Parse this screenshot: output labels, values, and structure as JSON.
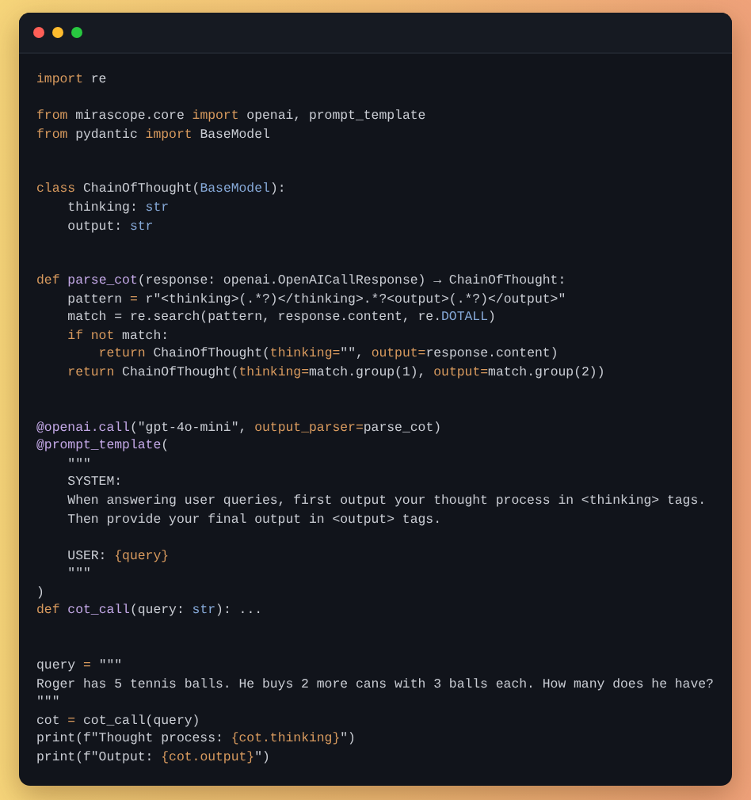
{
  "window": {
    "controls": [
      {
        "color": "#ff5f57"
      },
      {
        "color": "#febc2e"
      },
      {
        "color": "#28c840"
      }
    ]
  },
  "code": {
    "lines": [
      {
        "kind": "code",
        "tokens": [
          {
            "kind": "keyword",
            "text": "import"
          },
          {
            "kind": "plain",
            "text": " re"
          }
        ]
      },
      {
        "kind": "blank"
      },
      {
        "kind": "code",
        "tokens": [
          {
            "kind": "keyword",
            "text": "from"
          },
          {
            "kind": "plain",
            "text": " mirascope.core "
          },
          {
            "kind": "keyword",
            "text": "import"
          },
          {
            "kind": "plain",
            "text": " openai, prompt_template"
          }
        ]
      },
      {
        "kind": "code",
        "tokens": [
          {
            "kind": "keyword",
            "text": "from"
          },
          {
            "kind": "plain",
            "text": " pydantic "
          },
          {
            "kind": "keyword",
            "text": "import"
          },
          {
            "kind": "plain",
            "text": " BaseModel"
          }
        ]
      },
      {
        "kind": "blank"
      },
      {
        "kind": "blank"
      },
      {
        "kind": "code",
        "tokens": [
          {
            "kind": "keyword",
            "text": "class"
          },
          {
            "kind": "plain",
            "text": " ChainOfThought("
          },
          {
            "kind": "type",
            "text": "BaseModel"
          },
          {
            "kind": "plain",
            "text": "):"
          }
        ]
      },
      {
        "kind": "code",
        "tokens": [
          {
            "kind": "plain",
            "text": "    thinking: "
          },
          {
            "kind": "type",
            "text": "str"
          }
        ]
      },
      {
        "kind": "code",
        "tokens": [
          {
            "kind": "plain",
            "text": "    output: "
          },
          {
            "kind": "type",
            "text": "str"
          }
        ]
      },
      {
        "kind": "blank"
      },
      {
        "kind": "blank"
      },
      {
        "kind": "code",
        "tokens": [
          {
            "kind": "keyword",
            "text": "def"
          },
          {
            "kind": "function",
            "text": " parse_cot"
          },
          {
            "kind": "plain",
            "text": "(response: openai.OpenAICallResponse) → ChainOfThought:"
          }
        ]
      },
      {
        "kind": "code",
        "tokens": [
          {
            "kind": "plain",
            "text": "    pattern "
          },
          {
            "kind": "keyword",
            "text": "="
          },
          {
            "kind": "plain",
            "text": " r\"<thinking>(.*?)</thinking>.*?<output>(.*?)</output>\""
          }
        ]
      },
      {
        "kind": "code",
        "tokens": [
          {
            "kind": "plain",
            "text": "    match = re.search(pattern, response.content, re."
          },
          {
            "kind": "type",
            "text": "DOTALL"
          },
          {
            "kind": "plain",
            "text": ")"
          }
        ]
      },
      {
        "kind": "code",
        "tokens": [
          {
            "kind": "keyword",
            "text": "    if not"
          },
          {
            "kind": "plain",
            "text": " match:"
          }
        ]
      },
      {
        "kind": "code",
        "tokens": [
          {
            "kind": "keyword",
            "text": "        return"
          },
          {
            "kind": "plain",
            "text": " ChainOfThought("
          },
          {
            "kind": "keyword",
            "text": "thinking="
          },
          {
            "kind": "plain",
            "text": "\"\", "
          },
          {
            "kind": "keyword",
            "text": "output="
          },
          {
            "kind": "plain",
            "text": "response.content)"
          }
        ]
      },
      {
        "kind": "code",
        "tokens": [
          {
            "kind": "keyword",
            "text": "    return"
          },
          {
            "kind": "plain",
            "text": " ChainOfThought("
          },
          {
            "kind": "keyword",
            "text": "thinking="
          },
          {
            "kind": "plain",
            "text": "match.group(1), "
          },
          {
            "kind": "keyword",
            "text": "output="
          },
          {
            "kind": "plain",
            "text": "match.group(2))"
          }
        ]
      },
      {
        "kind": "blank"
      },
      {
        "kind": "blank"
      },
      {
        "kind": "code",
        "tokens": [
          {
            "kind": "function",
            "text": "@openai.call"
          },
          {
            "kind": "plain",
            "text": "(\"gpt-4o-mini\", "
          },
          {
            "kind": "keyword",
            "text": "output_parser="
          },
          {
            "kind": "plain",
            "text": "parse_cot)"
          }
        ]
      },
      {
        "kind": "code",
        "tokens": [
          {
            "kind": "function",
            "text": "@prompt_template"
          },
          {
            "kind": "plain",
            "text": "("
          }
        ]
      },
      {
        "kind": "code",
        "tokens": [
          {
            "kind": "plain",
            "text": "    \"\"\""
          }
        ]
      },
      {
        "kind": "code",
        "tokens": [
          {
            "kind": "plain",
            "text": "    SYSTEM:"
          }
        ]
      },
      {
        "kind": "code",
        "tokens": [
          {
            "kind": "plain",
            "text": "    When answering user queries, first output your thought process in <thinking> tags."
          }
        ]
      },
      {
        "kind": "code",
        "tokens": [
          {
            "kind": "plain",
            "text": "    Then provide your final output in <output> tags."
          }
        ]
      },
      {
        "kind": "blank"
      },
      {
        "kind": "code",
        "tokens": [
          {
            "kind": "plain",
            "text": "    USER: "
          },
          {
            "kind": "keyword",
            "text": "{query}"
          }
        ]
      },
      {
        "kind": "code",
        "tokens": [
          {
            "kind": "plain",
            "text": "    \"\"\""
          }
        ]
      },
      {
        "kind": "code",
        "tokens": [
          {
            "kind": "plain",
            "text": ")"
          }
        ]
      },
      {
        "kind": "code",
        "tokens": [
          {
            "kind": "keyword",
            "text": "def"
          },
          {
            "kind": "function",
            "text": " cot_call"
          },
          {
            "kind": "plain",
            "text": "(query: "
          },
          {
            "kind": "type",
            "text": "str"
          },
          {
            "kind": "plain",
            "text": "): ..."
          }
        ]
      },
      {
        "kind": "blank"
      },
      {
        "kind": "blank"
      },
      {
        "kind": "code",
        "tokens": [
          {
            "kind": "plain",
            "text": "query "
          },
          {
            "kind": "keyword",
            "text": "="
          },
          {
            "kind": "plain",
            "text": " \"\"\""
          }
        ]
      },
      {
        "kind": "code",
        "tokens": [
          {
            "kind": "plain",
            "text": "Roger has 5 tennis balls. He buys 2 more cans with 3 balls each. How many does he have?"
          }
        ]
      },
      {
        "kind": "code",
        "tokens": [
          {
            "kind": "plain",
            "text": "\"\"\""
          }
        ]
      },
      {
        "kind": "code",
        "tokens": [
          {
            "kind": "plain",
            "text": "cot "
          },
          {
            "kind": "keyword",
            "text": "="
          },
          {
            "kind": "plain",
            "text": " cot_call(query)"
          }
        ]
      },
      {
        "kind": "code",
        "tokens": [
          {
            "kind": "plain",
            "text": "print(f\"Thought process: "
          },
          {
            "kind": "keyword",
            "text": "{cot.thinking}"
          },
          {
            "kind": "plain",
            "text": "\")"
          }
        ]
      },
      {
        "kind": "code",
        "tokens": [
          {
            "kind": "plain",
            "text": "print(f\"Output: "
          },
          {
            "kind": "keyword",
            "text": "{cot.output}"
          },
          {
            "kind": "plain",
            "text": "\")"
          }
        ]
      }
    ]
  }
}
